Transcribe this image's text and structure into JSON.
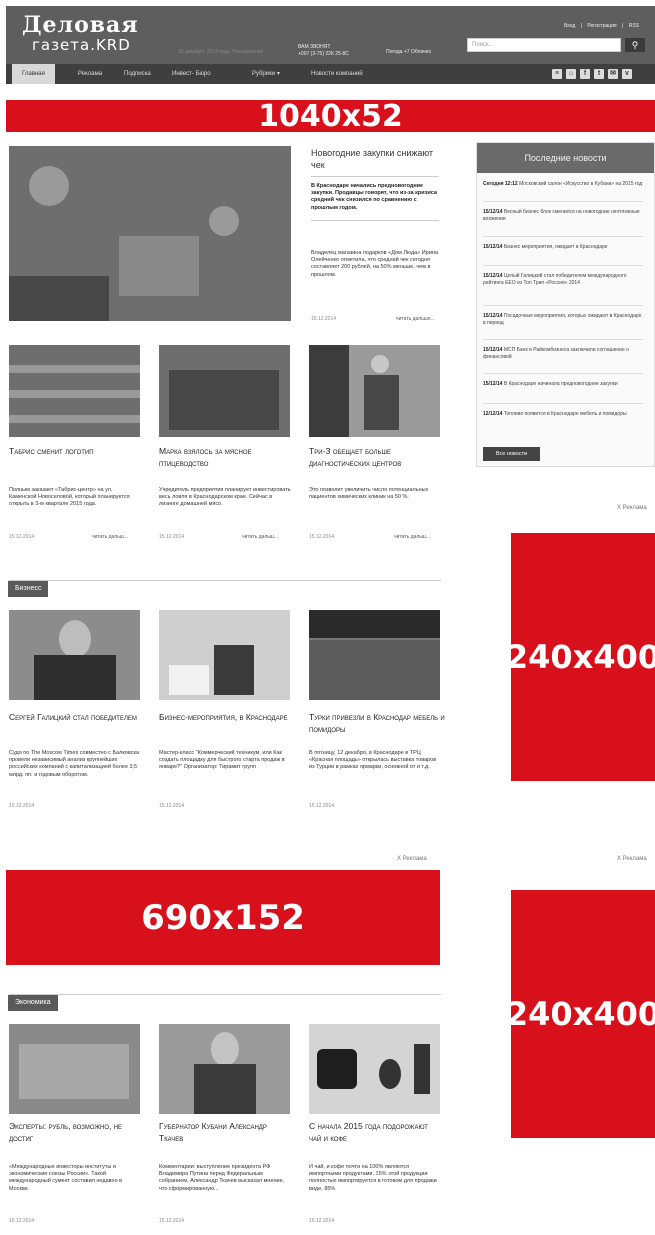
{
  "header": {
    "logo_line1": "Деловая",
    "logo_line2": "газета.KRD",
    "date": "15 декабря, 2014 года, Понедельник",
    "phone_label": "ВАМ ЗВОНЯТ",
    "phone": "+007 (3-75) 22К 25-8С",
    "weather": "Погода +7 Облачно",
    "top_links": [
      "Вход",
      "|",
      "Регистрация",
      "|",
      "RSS"
    ],
    "search_placeholder": "Поиск..."
  },
  "nav": {
    "items": [
      "Главная",
      "Реклама",
      "Подписка",
      "Инвест- Бюро",
      "Рубрики",
      "Новости компаний"
    ],
    "socials": [
      "rss-icon",
      "home-icon",
      "facebook-icon",
      "twitter-icon",
      "mail-icon",
      "vk-icon"
    ]
  },
  "ads": {
    "top": "1040x52",
    "mid": "690x152",
    "side1": "240x400",
    "side2": "240x400",
    "label": "X Реклама"
  },
  "featured": {
    "title": "Новогодние закупки снижают чек",
    "lead": "В Краснодаре начались предновогодние закупки. Продавцы говорят, что из-за кризиса средний чек снизился по сравнению с прошлым годом.",
    "body": "Владелец магазина подарков «Дом Люда» Ирина Олейченко отметила, что средний чек сегодня составляет 200 рублей, на 50% меньше, чем в прошлом.",
    "date": "15.12.2014",
    "more": "читать дальше..."
  },
  "cards_row1": [
    {
      "title": "Табрис сменит логотип",
      "text": "Полным заказает «Табрис-центр» на ул. Каменской Новоселовой, который планируется открыть в 3-м квартале 2015 года.",
      "date": "15.12.2014",
      "more": "читать дальш..."
    },
    {
      "title": "Марка взялось за мясное птицеводство",
      "text": "Учредитель предприятия планирует инвестировать весь ловля в Краснодарском крае. Сейчас в лизинге домашней мясо.",
      "date": "15.12.2014",
      "more": "читать дальш..."
    },
    {
      "title": "Три-З обещает больше диагностических центров",
      "text": "Это позволит увеличить число потенциальных пациентов химических клиник на 50 %.",
      "date": "15.12.2014",
      "more": "читать дальш..."
    }
  ],
  "sidebar": {
    "title": "Последние новости",
    "items": [
      {
        "time": "Сегодня 12:12",
        "text": "Московский салон «Искусство в Кубани» на 2015 год"
      },
      {
        "time": "15/12/14",
        "text": "Весный бизнес блок сменился на новогодние неотложные вложения"
      },
      {
        "time": "15/12/14",
        "text": "Бизнес мероприятия, ожидает в Краснодаре"
      },
      {
        "time": "15/12/14",
        "text": "Целый Галицкий стал победителем международного рейтинга ЕЕО из Топ Трип «Россия» 2014"
      },
      {
        "time": "15/12/14",
        "text": "Посадочные мероприятия, которых ожидают в Краснодаре в период"
      },
      {
        "time": "15/12/14",
        "text": "МСП Банк и Райкомбизнеса заключили соглашение о финансовой"
      },
      {
        "time": "15/12/14",
        "text": "В Краснодаре начинала предновогодние закупки"
      },
      {
        "time": "12/12/14",
        "text": "Топливо появится в Краснодаре мебель и помидоры"
      }
    ],
    "button": "Все новости"
  },
  "sections": {
    "business": "Бизнесс",
    "economy": "Экономика"
  },
  "cards_business": [
    {
      "title": "Сергей Галицкий стал победителем",
      "text": "Судя по The Moscow Times совместно с Балковска провели независимый анализ крупнейших российских компаний с капитализацией более 3,5 млрд. пп. и годовым оборотом.",
      "date": "15.12.2014"
    },
    {
      "title": "Бизнес-мероприятия, в Краснодаре",
      "text": "Мастер-класс \"Коммерческий техникум, или Как создать площадку для быстрого старта продаж в январе?\" Организатор: Тирамит групп",
      "date": "15.12.2014"
    },
    {
      "title": "Турки привезли в Краснодар мебель и помидоры",
      "text": "В пятницу, 12 декабря, в Краснодаре в ТРЦ «Красная площадь» открылась выставка товаров из Турции в рамках ярмарки, основной от и т.д.",
      "date": "15.12.2014"
    }
  ],
  "cards_economy": [
    {
      "title": "Эксперты: рубль, возможно, не достиг",
      "text": "«Международные инвесторы институты и экономические союзы России». Такой международный сумеет составил недавно в Москве.",
      "date": "15.12.2014"
    },
    {
      "title": "Губернатор Кубани Александр Ткачев",
      "text": "Комментарии: выступление президента РФ Владимира Путина перед Федеральным собранием, Александр Ткачев высказал мнение, что сформированную...",
      "date": "15.12.2014"
    },
    {
      "title": "С начала 2015 года подорожают чай и кофе",
      "text": "И чай, и кофе почти на 100% являются импортными продуктами. 15% этой продукции полностью импортируется в готовом для продажи виде, 85%",
      "date": "15.12.2014"
    }
  ]
}
